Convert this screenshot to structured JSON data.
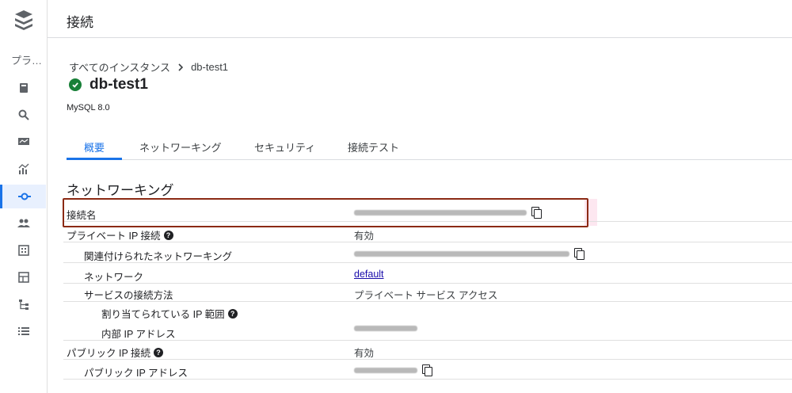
{
  "rail": {
    "label": "プラ…",
    "icons": [
      "storage-icon",
      "search-icon",
      "monitor-icon",
      "chart-icon",
      "connection-icon",
      "users-icon",
      "grid-icon",
      "layout-icon",
      "hierarchy-icon",
      "list-icon"
    ],
    "active_index": 4
  },
  "header": {
    "title": "接続"
  },
  "breadcrumb": {
    "parent": "すべてのインスタンス",
    "current": "db-test1"
  },
  "instance": {
    "name": "db-test1",
    "version": "MySQL 8.0",
    "status_color": "#188038"
  },
  "tabs": [
    "概要",
    "ネットワーキング",
    "セキュリティ",
    "接続テスト"
  ],
  "section": {
    "title": "ネットワーキング"
  },
  "rows": {
    "connection_name": {
      "label": "接続名"
    },
    "private_ip": {
      "label": "プライベート IP 接続",
      "value": "有効"
    },
    "associated_network": {
      "label": "関連付けられたネットワーキング"
    },
    "network": {
      "label": "ネットワーク",
      "value": "default"
    },
    "service_connection": {
      "label": "サービスの接続方法",
      "value": "プライベート サービス アクセス"
    },
    "allocated_range": {
      "label": "割り当てられている IP 範囲"
    },
    "internal_ip": {
      "label": "内部 IP アドレス"
    },
    "public_ip": {
      "label": "パブリック IP 接続",
      "value": "有効"
    },
    "public_ip_address": {
      "label": "パブリック IP アドレス"
    }
  },
  "colors": {
    "accent": "#1a73e8",
    "highlight_border": "#8b2a14"
  }
}
